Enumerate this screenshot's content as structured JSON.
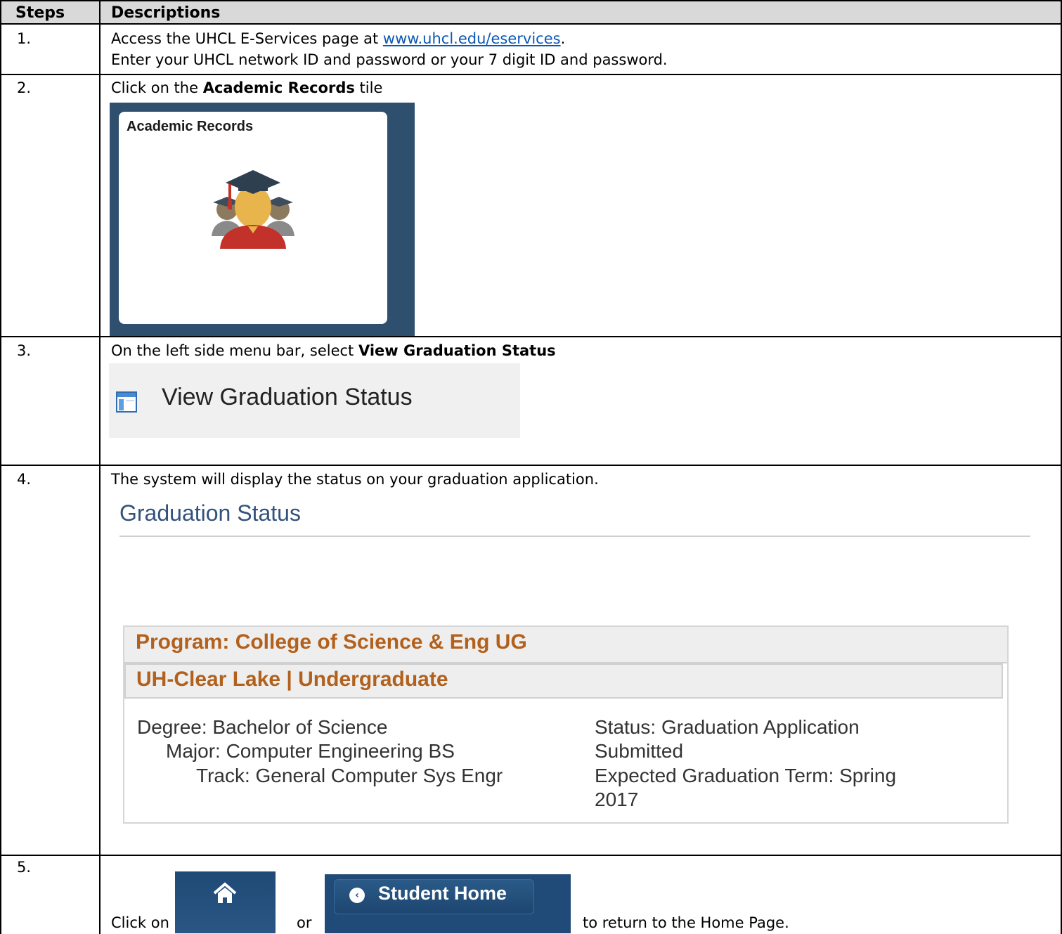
{
  "table": {
    "headers": [
      "Steps",
      "Descriptions"
    ]
  },
  "steps": [
    {
      "number": "1.",
      "line1_prefix": "Access the UHCL E-Services page at ",
      "link_text": "www.uhcl.edu/eservices",
      "line1_suffix": ".",
      "line2": "Enter your UHCL network ID and password or your 7 digit ID and password."
    },
    {
      "number": "2.",
      "prefix": "Click on the ",
      "bold": "Academic Records",
      "suffix": " tile",
      "tile_title": "Academic Records",
      "tile_icon": "graduation-students-icon"
    },
    {
      "number": "3.",
      "prefix": "On the left side menu bar, select ",
      "bold": "View Graduation Status",
      "menu_label": "View Graduation Status",
      "menu_icon": "page-layout-icon"
    },
    {
      "number": "4.",
      "text": "The system will display the status on your graduation application.",
      "panel_title": "Graduation Status",
      "program": "Program: College of Science & Eng UG",
      "career": "UH-Clear Lake | Undergraduate",
      "degree": "Degree: Bachelor of Science",
      "major": "Major: Computer Engineering BS",
      "track": "Track: General Computer Sys Engr",
      "status_line1": "Status: Graduation Application",
      "status_line2": "Submitted",
      "term_line1": "Expected Graduation Term: Spring",
      "term_line2": "2017"
    },
    {
      "number": "5.",
      "prefix": "Click on",
      "middle": "or",
      "suffix": "to return to the Home Page.",
      "home_icon": "home-icon",
      "student_home_label": "Student Home"
    }
  ],
  "colors": {
    "header_bg": "#d9d9d9",
    "link": "#0b57b5",
    "tile_bg": "#2f4f6f",
    "panel_title": "#33527a",
    "program_text": "#b2611d",
    "button_bg": "#204a77"
  }
}
